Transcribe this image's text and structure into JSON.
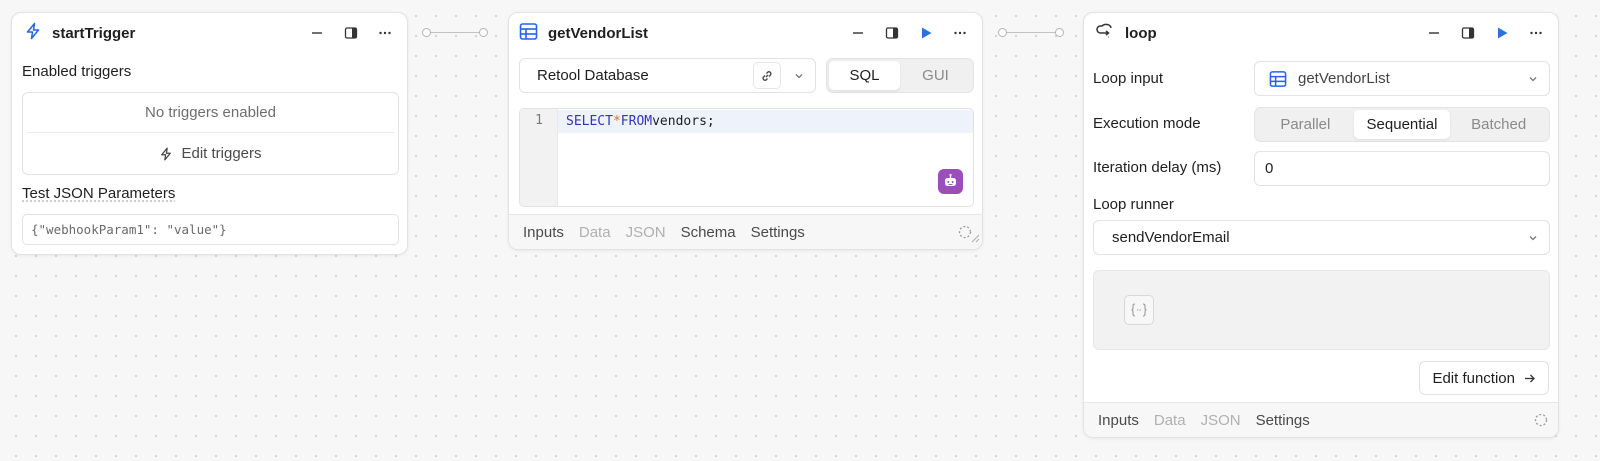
{
  "canvas": {
    "connector_icon": "connector-line"
  },
  "start_trigger": {
    "title": "startTrigger",
    "icon": "bolt-icon",
    "enabled_triggers_label": "Enabled triggers",
    "no_triggers_text": "No triggers enabled",
    "edit_triggers_label": "Edit triggers",
    "test_json_label": "Test JSON Parameters",
    "test_json_value": "{\"webhookParam1\": \"value\"}"
  },
  "get_vendor_list": {
    "title": "getVendorList",
    "icon": "table-icon",
    "resource": "Retool Database",
    "mode_options": [
      "SQL",
      "GUI"
    ],
    "mode_selected": "SQL",
    "code": {
      "line_number": "1",
      "tokens": [
        "SELECT",
        "*",
        "FROM",
        "vendors;"
      ]
    },
    "footer_tabs": [
      {
        "label": "Inputs",
        "enabled": true
      },
      {
        "label": "Data",
        "enabled": false
      },
      {
        "label": "JSON",
        "enabled": false
      },
      {
        "label": "Schema",
        "enabled": true
      },
      {
        "label": "Settings",
        "enabled": true
      }
    ],
    "accent_color": "#9b4dbb"
  },
  "loop": {
    "title": "loop",
    "icon": "loop-icon",
    "loop_input_label": "Loop input",
    "loop_input_value": "getVendorList",
    "execution_mode_label": "Execution mode",
    "execution_modes": [
      "Parallel",
      "Sequential",
      "Batched"
    ],
    "execution_mode_selected": "Sequential",
    "iteration_delay_label": "Iteration delay (ms)",
    "iteration_delay_value": "0",
    "loop_runner_label": "Loop runner",
    "loop_runner_value": "sendVendorEmail",
    "edit_function_label": "Edit function",
    "footer_tabs": [
      {
        "label": "Inputs",
        "enabled": true
      },
      {
        "label": "Data",
        "enabled": false
      },
      {
        "label": "JSON",
        "enabled": false
      },
      {
        "label": "Settings",
        "enabled": true
      }
    ]
  },
  "colors": {
    "accent_blue": "#2563eb",
    "play_blue": "#2f6fe6"
  }
}
